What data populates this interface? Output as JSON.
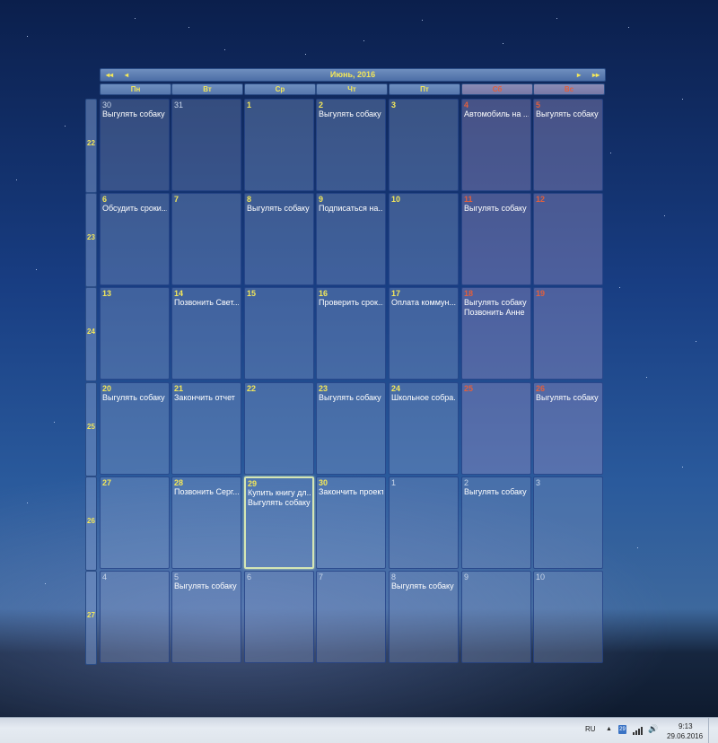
{
  "calendar": {
    "title": "Июнь, 2016",
    "nav": {
      "prev_year": "◂◂",
      "prev_month": "◂",
      "next_month": "▸",
      "next_year": "▸▸"
    },
    "day_headers": [
      "Пн",
      "Вт",
      "Ср",
      "Чт",
      "Пт",
      "Сб",
      "Вс"
    ],
    "weeks": [
      {
        "number": "22",
        "days": [
          {
            "date": "30",
            "other": true,
            "events": [
              "Выгулять собаку"
            ]
          },
          {
            "date": "31",
            "other": true,
            "events": []
          },
          {
            "date": "1",
            "events": []
          },
          {
            "date": "2",
            "events": [
              "Выгулять собаку"
            ]
          },
          {
            "date": "3",
            "events": []
          },
          {
            "date": "4",
            "weekend": true,
            "events": [
              "Автомобиль на ..."
            ]
          },
          {
            "date": "5",
            "weekend": true,
            "events": [
              "Выгулять собаку"
            ]
          }
        ]
      },
      {
        "number": "23",
        "days": [
          {
            "date": "6",
            "events": [
              "Обсудить сроки..."
            ]
          },
          {
            "date": "7",
            "events": []
          },
          {
            "date": "8",
            "events": [
              "Выгулять собаку"
            ]
          },
          {
            "date": "9",
            "events": [
              "Подписаться на..."
            ]
          },
          {
            "date": "10",
            "events": []
          },
          {
            "date": "11",
            "weekend": true,
            "events": [
              "Выгулять собаку"
            ]
          },
          {
            "date": "12",
            "weekend": true,
            "events": []
          }
        ]
      },
      {
        "number": "24",
        "days": [
          {
            "date": "13",
            "events": []
          },
          {
            "date": "14",
            "events": [
              "Позвонить Свет..."
            ]
          },
          {
            "date": "15",
            "events": []
          },
          {
            "date": "16",
            "events": [
              "Проверить срок..."
            ]
          },
          {
            "date": "17",
            "events": [
              "Оплата коммун..."
            ]
          },
          {
            "date": "18",
            "weekend": true,
            "events": [
              "Выгулять собаку",
              "Позвонить Анне"
            ]
          },
          {
            "date": "19",
            "weekend": true,
            "events": []
          }
        ]
      },
      {
        "number": "25",
        "days": [
          {
            "date": "20",
            "events": [
              "Выгулять собаку"
            ]
          },
          {
            "date": "21",
            "events": [
              "Закончить отчет"
            ]
          },
          {
            "date": "22",
            "events": []
          },
          {
            "date": "23",
            "events": [
              "Выгулять собаку"
            ]
          },
          {
            "date": "24",
            "events": [
              "Школьное собра..."
            ]
          },
          {
            "date": "25",
            "weekend": true,
            "events": []
          },
          {
            "date": "26",
            "weekend": true,
            "events": [
              "Выгулять собаку"
            ]
          }
        ]
      },
      {
        "number": "26",
        "days": [
          {
            "date": "27",
            "events": []
          },
          {
            "date": "28",
            "events": [
              "Позвонить Серг..."
            ]
          },
          {
            "date": "29",
            "today": true,
            "events": [
              "Купить книгу дл...",
              "Выгулять собаку"
            ]
          },
          {
            "date": "30",
            "events": [
              "Закончить проект"
            ]
          },
          {
            "date": "1",
            "other": true,
            "events": []
          },
          {
            "date": "2",
            "other": true,
            "events": [
              "Выгулять собаку"
            ]
          },
          {
            "date": "3",
            "other": true,
            "events": []
          }
        ]
      },
      {
        "number": "27",
        "days": [
          {
            "date": "4",
            "other": true,
            "events": []
          },
          {
            "date": "5",
            "other": true,
            "events": [
              "Выгулять собаку"
            ]
          },
          {
            "date": "6",
            "other": true,
            "events": []
          },
          {
            "date": "7",
            "other": true,
            "events": []
          },
          {
            "date": "8",
            "other": true,
            "events": [
              "Выгулять собаку"
            ]
          },
          {
            "date": "9",
            "other": true,
            "events": []
          },
          {
            "date": "10",
            "other": true,
            "events": []
          }
        ]
      }
    ]
  },
  "taskbar": {
    "language": "RU",
    "tray_overflow": "▲",
    "clock_time": "9:13",
    "clock_date": "29.06.2016",
    "calendar_badge": "29"
  },
  "colors": {
    "accent_text": "#f3e75a",
    "weekend_text": "#e25f3c",
    "event_text": "#ffffff"
  },
  "icons": [
    "first-page-icon",
    "previous-icon",
    "next-icon",
    "last-page-icon",
    "calendar-tray-icon",
    "network-signal-icon",
    "speaker-icon"
  ]
}
